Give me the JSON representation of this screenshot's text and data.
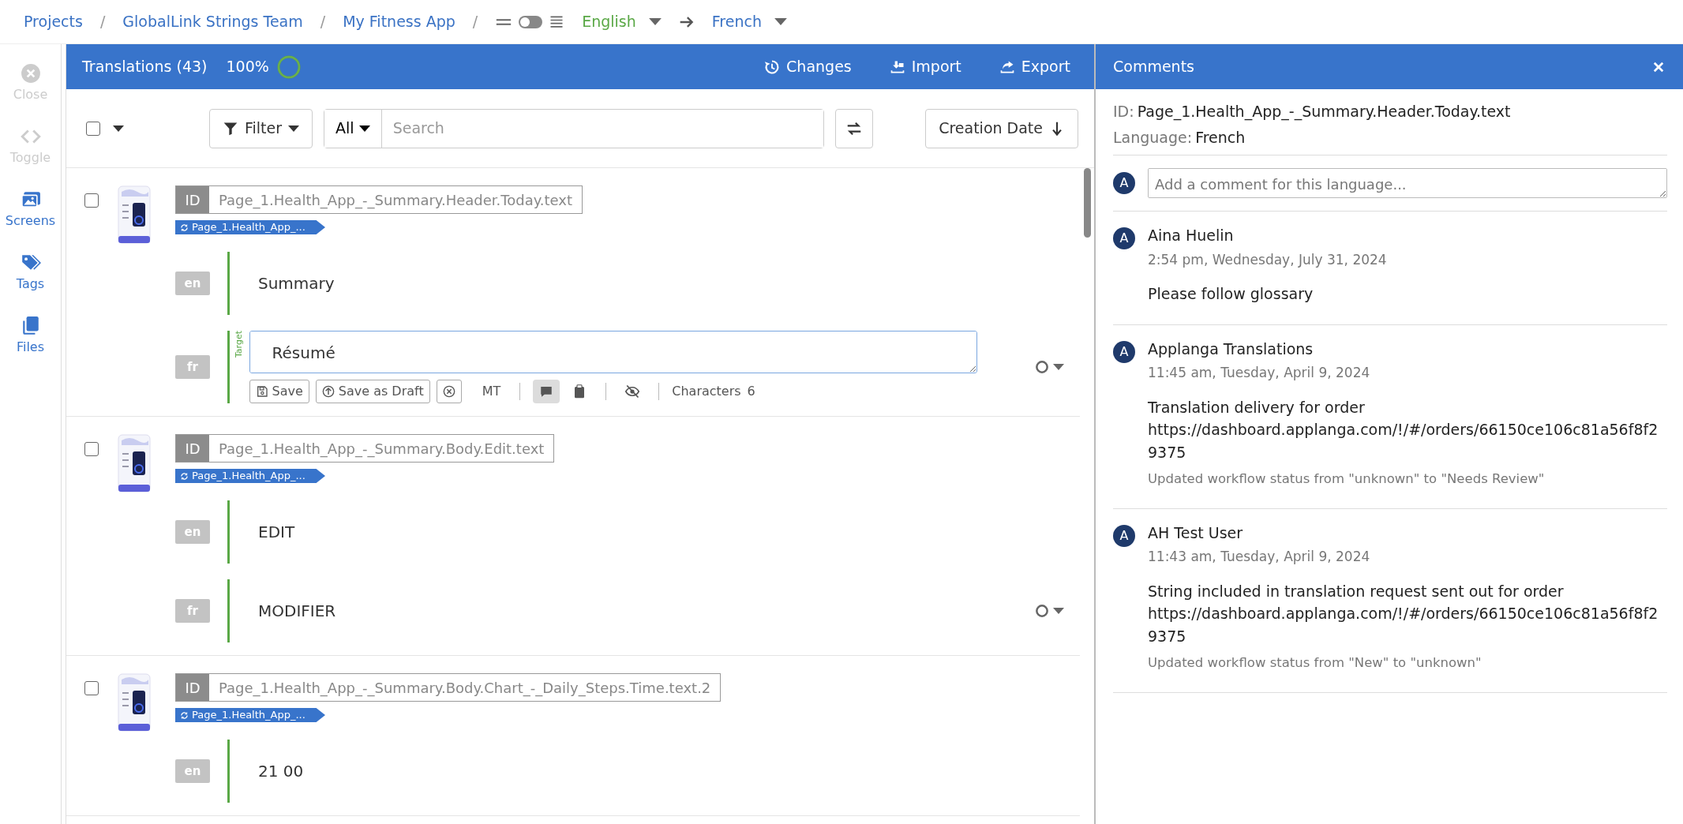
{
  "breadcrumbs": [
    {
      "label": "Projects"
    },
    {
      "label": "GlobalLink Strings Team"
    },
    {
      "label": "My Fitness App"
    }
  ],
  "breadcrumb_separators": [
    "/",
    "/",
    "/"
  ],
  "view_toggle": {
    "on": false
  },
  "source_language": "English",
  "target_language": "French",
  "sidebar": {
    "items": [
      {
        "label": "Close",
        "kind": "close",
        "disabled": true
      },
      {
        "label": "Toggle",
        "kind": "toggle",
        "disabled": true
      },
      {
        "label": "Screens",
        "kind": "screens",
        "disabled": false
      },
      {
        "label": "Tags",
        "kind": "tags",
        "disabled": false
      },
      {
        "label": "Files",
        "kind": "files",
        "disabled": false
      }
    ]
  },
  "header": {
    "title": "Translations (43)",
    "percent": "100%",
    "progress": {
      "level": 1
    },
    "actions": [
      {
        "label": "Changes",
        "kind": "changes"
      },
      {
        "label": "Import",
        "kind": "import"
      },
      {
        "label": "Export",
        "kind": "export"
      }
    ]
  },
  "toolbar": {
    "select_all": {
      "checked": false
    },
    "filter": "Filter",
    "scope": "All",
    "search": {
      "placeholder": "Search"
    },
    "sort": "Creation Date"
  },
  "strings": [
    {
      "checked": false,
      "id_label": "ID",
      "id": "Page_1.Health_App_-_Summary.Header.Today.text",
      "tag": "Page_1.Health_App_...",
      "rows": [
        {
          "kind": "source",
          "lang": "en",
          "text": "Summary"
        },
        {
          "kind": "editing",
          "lang": "fr",
          "text": "Résumé",
          "label": "Target",
          "tools": [
            {
              "kind": "save",
              "label": "Save",
              "on": false
            },
            {
              "kind": "draft",
              "label": "Save as Draft",
              "on": false
            },
            {
              "kind": "cancel",
              "on": false
            },
            {
              "kind": "mt",
              "label": "MT",
              "on": false
            },
            {
              "kind": "comment",
              "on": true
            },
            {
              "kind": "clipboard",
              "on": false
            },
            {
              "kind": "hide",
              "on": false
            }
          ],
          "characters_label": "Characters",
          "characters": "6"
        }
      ]
    },
    {
      "checked": false,
      "id_label": "ID",
      "id": "Page_1.Health_App_-_Summary.Body.Edit.text",
      "tag": "Page_1.Health_App_...",
      "rows": [
        {
          "kind": "source",
          "lang": "en",
          "text": "EDIT"
        },
        {
          "kind": "target",
          "lang": "fr",
          "text": "MODIFIER"
        }
      ]
    },
    {
      "checked": false,
      "id_label": "ID",
      "id": "Page_1.Health_App_-_Summary.Body.Chart_-_Daily_Steps.Time.text.2",
      "tag": "Page_1.Health_App_...",
      "rows": [
        {
          "kind": "source",
          "lang": "en",
          "text": "21 00"
        }
      ]
    }
  ],
  "comments": {
    "title": "Comments",
    "id_label": "ID:",
    "id": "Page_1.Health_App_-_Summary.Header.Today.text",
    "language_label": "Language:",
    "language": "French",
    "input": {
      "avatar": "A",
      "placeholder": "Add a comment for this language..."
    },
    "items": [
      {
        "avatar": "A",
        "author": "Aina Huelin",
        "time": "2:54 pm, Wednesday, July 31, 2024",
        "body": "Please follow glossary"
      },
      {
        "avatar": "A",
        "author": "Applanga Translations",
        "time": "11:45 am, Tuesday, April 9, 2024",
        "body": "Translation delivery for order https://dashboard.applanga.com/!/#/orders/66150ce106c81a56f8f29375",
        "status": "Updated workflow status from \"unknown\" to \"Needs Review\""
      },
      {
        "avatar": "A",
        "author": "AH Test User",
        "time": "11:43 am, Tuesday, April 9, 2024",
        "body": "String included in translation request sent out for order https://dashboard.applanga.com/!/#/orders/66150ce106c81a56f8f29375",
        "status": "Updated workflow status from \"New\" to \"unknown\""
      }
    ]
  }
}
